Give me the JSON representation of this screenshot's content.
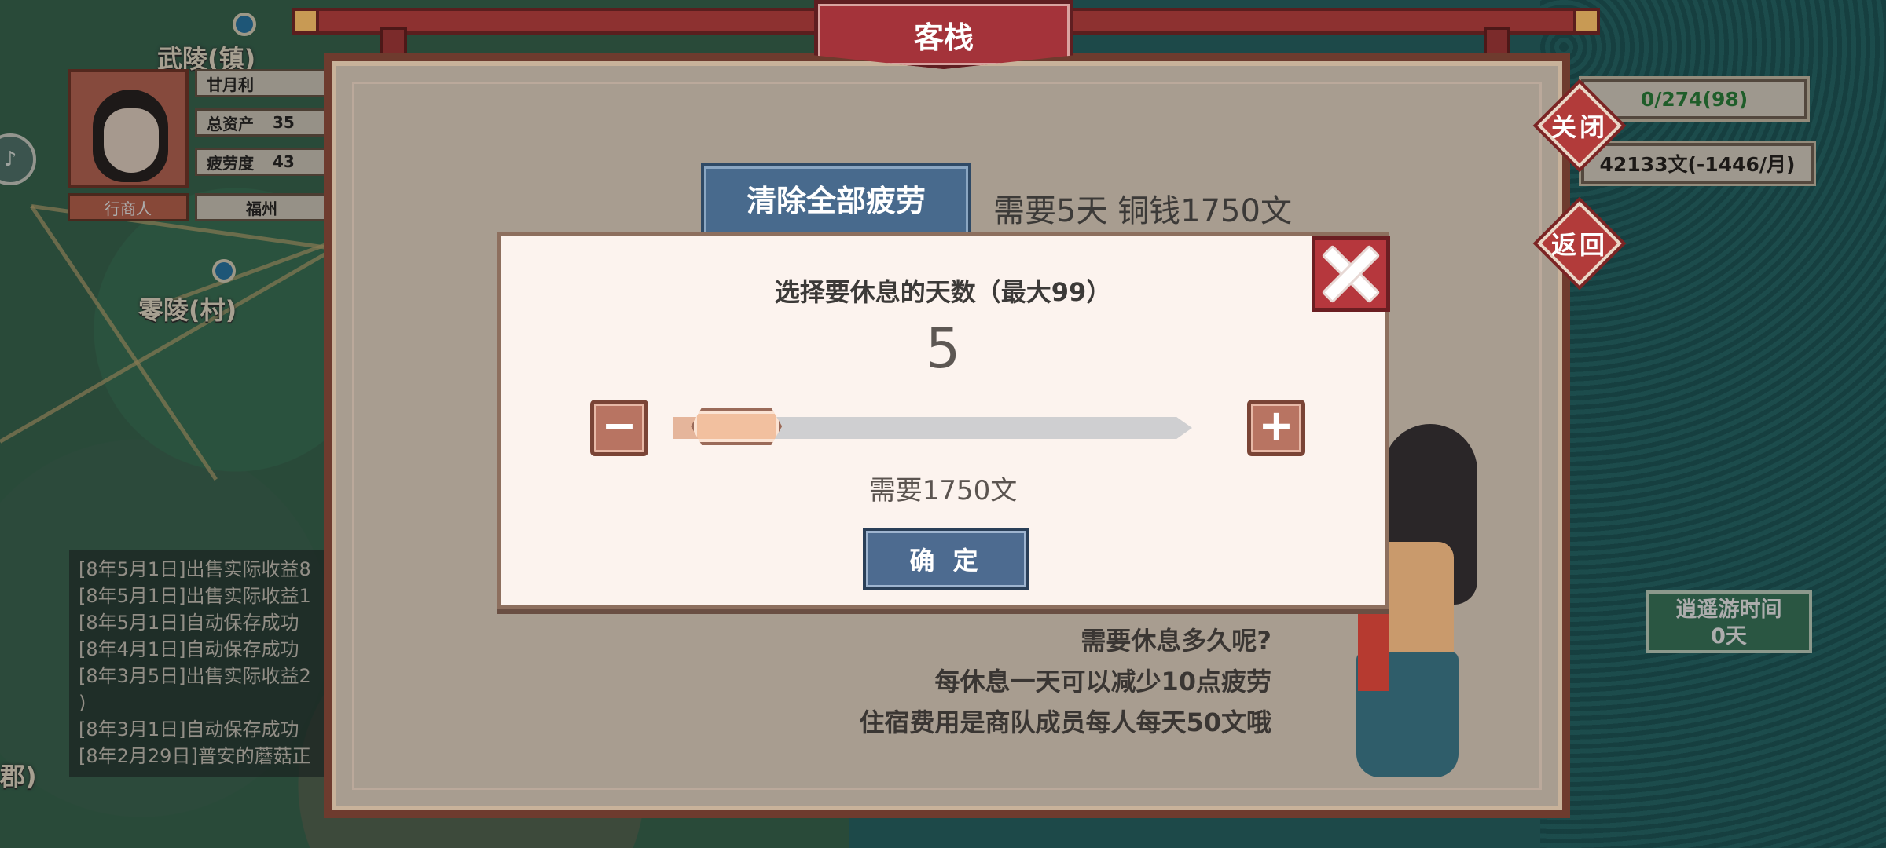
{
  "map": {
    "labels": [
      "武陵(镇)",
      "零陵(村)",
      "郡)"
    ]
  },
  "player": {
    "name": "甘月利",
    "total_assets_label": "总资产",
    "total_assets_value": "35",
    "fatigue_label": "疲劳度",
    "fatigue_value": "43",
    "role": "行商人",
    "location": "福州"
  },
  "log": [
    "[8年5月1日]出售实际收益8",
    "[8年5月1日]出售实际收益1",
    "[8年5月1日]自动保存成功",
    "[8年4月1日]自动保存成功",
    "[8年3月5日]出售实际收益2",
    ")",
    "[8年3月1日]自动保存成功",
    "[8年2月29日]普安的蘑菇正"
  ],
  "hud": {
    "cargo": "0/274(98)",
    "money": "42133文(-1446/月)",
    "close_label": "关闭",
    "back_label": "返回",
    "travel_time_label": "逍遥游时间",
    "travel_time_value": "0天",
    "colors": {
      "cargo_text": "#2e8a3e",
      "money_text": "#2a2622"
    }
  },
  "inn": {
    "title": "客栈",
    "clear_all_button": "清除全部疲劳",
    "clear_all_cost": "需要5天 铜钱1750文",
    "speech": [
      "需要休息多久呢?",
      "每休息一天可以减少10点疲劳",
      "住宿费用是商队成员每人每天50文哦"
    ]
  },
  "dialog": {
    "title": "选择要休息的天数（最大99）",
    "value": "5",
    "minus_label": "−",
    "plus_label": "+",
    "slider": {
      "min": 1,
      "max": 99,
      "value": 5
    },
    "cost": "需要1750文",
    "confirm": "确 定"
  }
}
